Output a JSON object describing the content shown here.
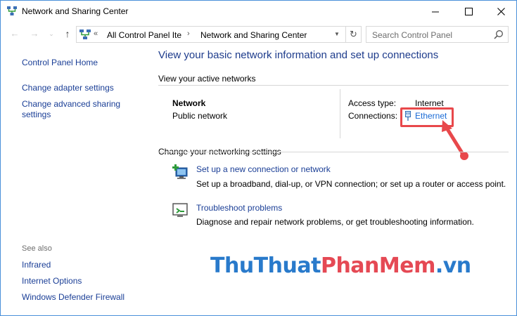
{
  "window": {
    "title": "Network and Sharing Center",
    "minimize": "—",
    "maximize": "☐",
    "close": "✕"
  },
  "nav": {
    "back": "←",
    "forward": "→",
    "recent": "⌄",
    "up": "↑",
    "chevron": "«",
    "breadcrumb": [
      "All Control Panel Ite",
      "Network and Sharing Center"
    ],
    "separator": "›",
    "dropdown": "▼",
    "refresh": "↻",
    "search_placeholder": "Search Control Panel"
  },
  "sidebar": {
    "home": "Control Panel Home",
    "links": [
      "Change adapter settings",
      "Change advanced sharing settings"
    ],
    "see_also_heading": "See also",
    "see_also": [
      "Infrared",
      "Internet Options",
      "Windows Defender Firewall"
    ]
  },
  "main": {
    "title": "View your basic network information and set up connections",
    "active_networks_heading": "View your active networks",
    "network": {
      "name": "Network",
      "category": "Public network",
      "access_type_label": "Access type:",
      "access_type_value": "Internet",
      "connections_label": "Connections:",
      "connection_name": "Ethernet"
    },
    "change_settings_heading": "Change your networking settings",
    "tasks": [
      {
        "link": "Set up a new connection or network",
        "description": "Set up a broadband, dial-up, or VPN connection; or set up a router or access point.",
        "icon": "new-connection-icon"
      },
      {
        "link": "Troubleshoot problems",
        "description": "Diagnose and repair network problems, or get troubleshooting information.",
        "icon": "troubleshoot-icon"
      }
    ]
  },
  "watermark": {
    "part1": "ThuThuat",
    "part2": "PhanMem",
    "part3": ".vn"
  },
  "colors": {
    "link": "#1a3e96",
    "title": "#1e3c8c",
    "highlight": "#e8484b",
    "watermark_blue": "#1e73c9",
    "watermark_red": "#e4404b"
  }
}
